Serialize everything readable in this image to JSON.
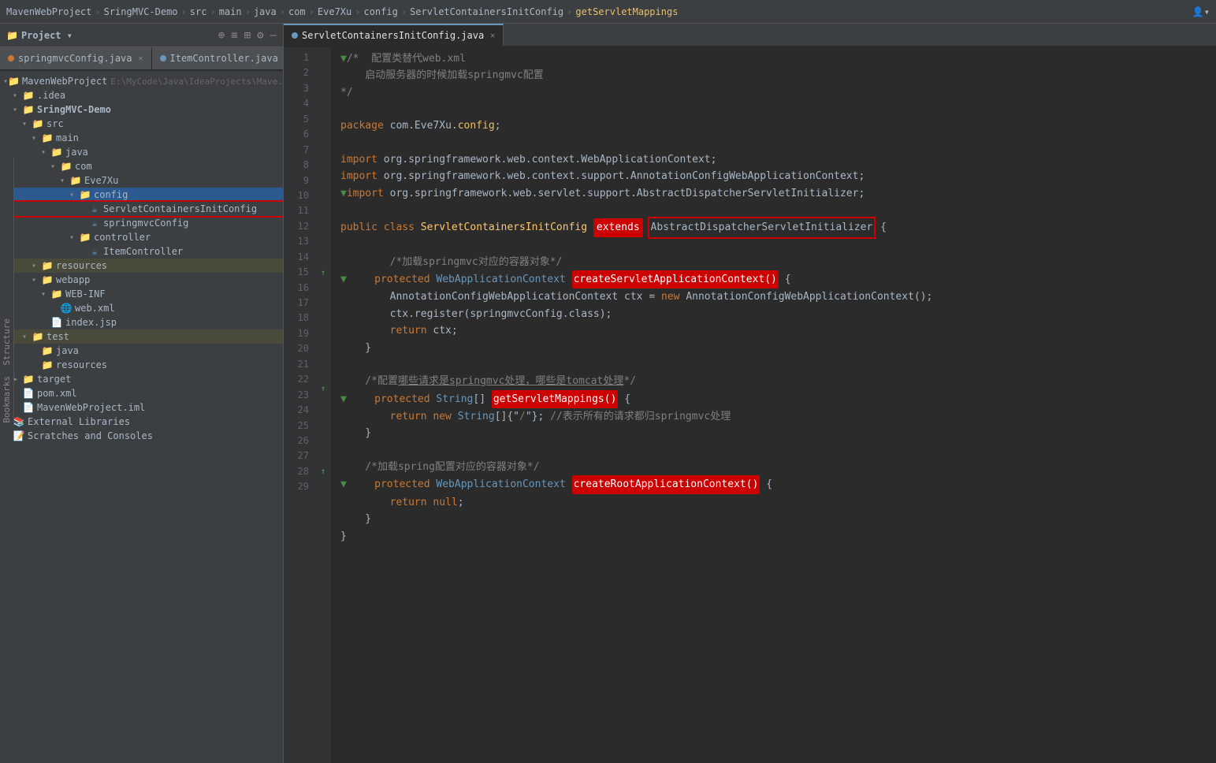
{
  "topbar": {
    "breadcrumb": [
      "MavenWebProject",
      "SringMVC-Demo",
      "src",
      "main",
      "java",
      "com",
      "Eve7Xu",
      "config",
      "ServletContainersInitConfig",
      "getServletMappings"
    ],
    "user_icon": "👤"
  },
  "tabs": [
    {
      "label": "springmvcConfig.java",
      "type": "orange",
      "active": false
    },
    {
      "label": "ItemController.java",
      "type": "blue",
      "active": false
    },
    {
      "label": "ServletContainersInitConfig.java",
      "type": "blue",
      "active": true
    }
  ],
  "sidebar": {
    "title": "Project",
    "items": [
      {
        "indent": 0,
        "arrow": "▾",
        "icon": "📁",
        "name": "MavenWebProject",
        "path": "E:\\MyCode\\Java\\IdeaProjects\\Mave..."
      },
      {
        "indent": 1,
        "arrow": "▾",
        "icon": "📁",
        "name": ".idea"
      },
      {
        "indent": 1,
        "arrow": "▾",
        "icon": "📁",
        "name": "SringMVC-Demo",
        "bold": true
      },
      {
        "indent": 2,
        "arrow": "▾",
        "icon": "📁",
        "name": "src"
      },
      {
        "indent": 3,
        "arrow": "▾",
        "icon": "📁",
        "name": "main"
      },
      {
        "indent": 4,
        "arrow": "▾",
        "icon": "📁",
        "name": "java"
      },
      {
        "indent": 5,
        "arrow": "▾",
        "icon": "📁",
        "name": "com"
      },
      {
        "indent": 6,
        "arrow": "▾",
        "icon": "📁",
        "name": "Eve7Xu"
      },
      {
        "indent": 7,
        "arrow": "▾",
        "icon": "📁",
        "name": "config",
        "selected": true
      },
      {
        "indent": 8,
        "arrow": "",
        "icon": "☕",
        "name": "ServletContainersInitConfig",
        "highlighted": true
      },
      {
        "indent": 8,
        "arrow": "",
        "icon": "☕",
        "name": "springmvcConfig"
      },
      {
        "indent": 7,
        "arrow": "▾",
        "icon": "📁",
        "name": "controller"
      },
      {
        "indent": 8,
        "arrow": "",
        "icon": "☕",
        "name": "ItemController"
      },
      {
        "indent": 3,
        "arrow": "▾",
        "icon": "📁",
        "name": "resources"
      },
      {
        "indent": 3,
        "arrow": "▾",
        "icon": "📁",
        "name": "webapp"
      },
      {
        "indent": 4,
        "arrow": "▾",
        "icon": "📁",
        "name": "WEB-INF"
      },
      {
        "indent": 5,
        "arrow": "",
        "icon": "🌐",
        "name": "web.xml"
      },
      {
        "indent": 4,
        "arrow": "",
        "icon": "📄",
        "name": "index.jsp"
      },
      {
        "indent": 2,
        "arrow": "▾",
        "icon": "📁",
        "name": "test"
      },
      {
        "indent": 3,
        "arrow": "",
        "icon": "📁",
        "name": "java"
      },
      {
        "indent": 3,
        "arrow": "",
        "icon": "📁",
        "name": "resources"
      },
      {
        "indent": 1,
        "arrow": "▶",
        "icon": "📁",
        "name": "target"
      },
      {
        "indent": 1,
        "arrow": "",
        "icon": "📄",
        "name": "pom.xml"
      },
      {
        "indent": 1,
        "arrow": "",
        "icon": "📄",
        "name": "MavenWebProject.iml"
      },
      {
        "indent": 0,
        "arrow": "▶",
        "icon": "📚",
        "name": "External Libraries"
      },
      {
        "indent": 0,
        "arrow": "",
        "icon": "📝",
        "name": "Scratches and Consoles"
      }
    ]
  },
  "code": {
    "lines": [
      {
        "num": 1,
        "gutter": "",
        "content": "/*  配置类替代web.xml"
      },
      {
        "num": 2,
        "gutter": "",
        "content": "    启动服务器的时候加载springmvc配置"
      },
      {
        "num": 3,
        "gutter": "",
        "content": "*/"
      },
      {
        "num": 4,
        "gutter": "",
        "content": ""
      },
      {
        "num": 5,
        "gutter": "",
        "content": "package com.Eve7Xu.config;"
      },
      {
        "num": 6,
        "gutter": "",
        "content": ""
      },
      {
        "num": 7,
        "gutter": "",
        "content": "import org.springframework.web.context.WebApplicationContext;"
      },
      {
        "num": 8,
        "gutter": "",
        "content": "import org.springframework.web.context.support.AnnotationConfigWebApplicationContext;"
      },
      {
        "num": 9,
        "gutter": "",
        "content": "import org.springframework.web.servlet.support.AbstractDispatcherServletInitializer;"
      },
      {
        "num": 10,
        "gutter": "",
        "content": ""
      },
      {
        "num": 11,
        "gutter": "",
        "content": "public class ServletContainersInitConfig [extends] AbstractDispatcherServletInitializer {"
      },
      {
        "num": 12,
        "gutter": "",
        "content": ""
      },
      {
        "num": 13,
        "gutter": "",
        "content": "    /*加载springmvc对应的容器对象*/"
      },
      {
        "num": 14,
        "gutter": "↑",
        "content": "    protected WebApplicationContext [createServletApplicationContext()] {"
      },
      {
        "num": 15,
        "gutter": "",
        "content": "        AnnotationConfigWebApplicationContext ctx = new AnnotationConfigWebApplicationContext();"
      },
      {
        "num": 16,
        "gutter": "",
        "content": "        ctx.register(springmvcConfig.class);"
      },
      {
        "num": 17,
        "gutter": "",
        "content": "        return ctx;"
      },
      {
        "num": 18,
        "gutter": "",
        "content": "    }"
      },
      {
        "num": 19,
        "gutter": "",
        "content": ""
      },
      {
        "num": 20,
        "gutter": "",
        "content": "    /*配置哪些请求是springmvc处理，哪些是tomcat处理*/"
      },
      {
        "num": 21,
        "gutter": "↑",
        "content": "    protected String[] [getServletMappings()] {"
      },
      {
        "num": 22,
        "gutter": "",
        "content": "        return new String[]{\"/\"}; //表示所有的请求都归springmvc处理"
      },
      {
        "num": 23,
        "gutter": "",
        "content": "    }"
      },
      {
        "num": 24,
        "gutter": "",
        "content": ""
      },
      {
        "num": 25,
        "gutter": "",
        "content": "    /*加载spring配置对应的容器对象*/"
      },
      {
        "num": 26,
        "gutter": "↑",
        "content": "    protected WebApplicationContext [createRootApplicationContext()] {"
      },
      {
        "num": 27,
        "gutter": "",
        "content": "        return null;"
      },
      {
        "num": 28,
        "gutter": "",
        "content": "    }"
      },
      {
        "num": 29,
        "gutter": "",
        "content": "}"
      }
    ]
  },
  "colors": {
    "accent": "#cc0000",
    "keyword": "#cc7832",
    "string": "#6a8759",
    "comment": "#808080",
    "type": "#6897bb",
    "method": "#ffc66d"
  }
}
